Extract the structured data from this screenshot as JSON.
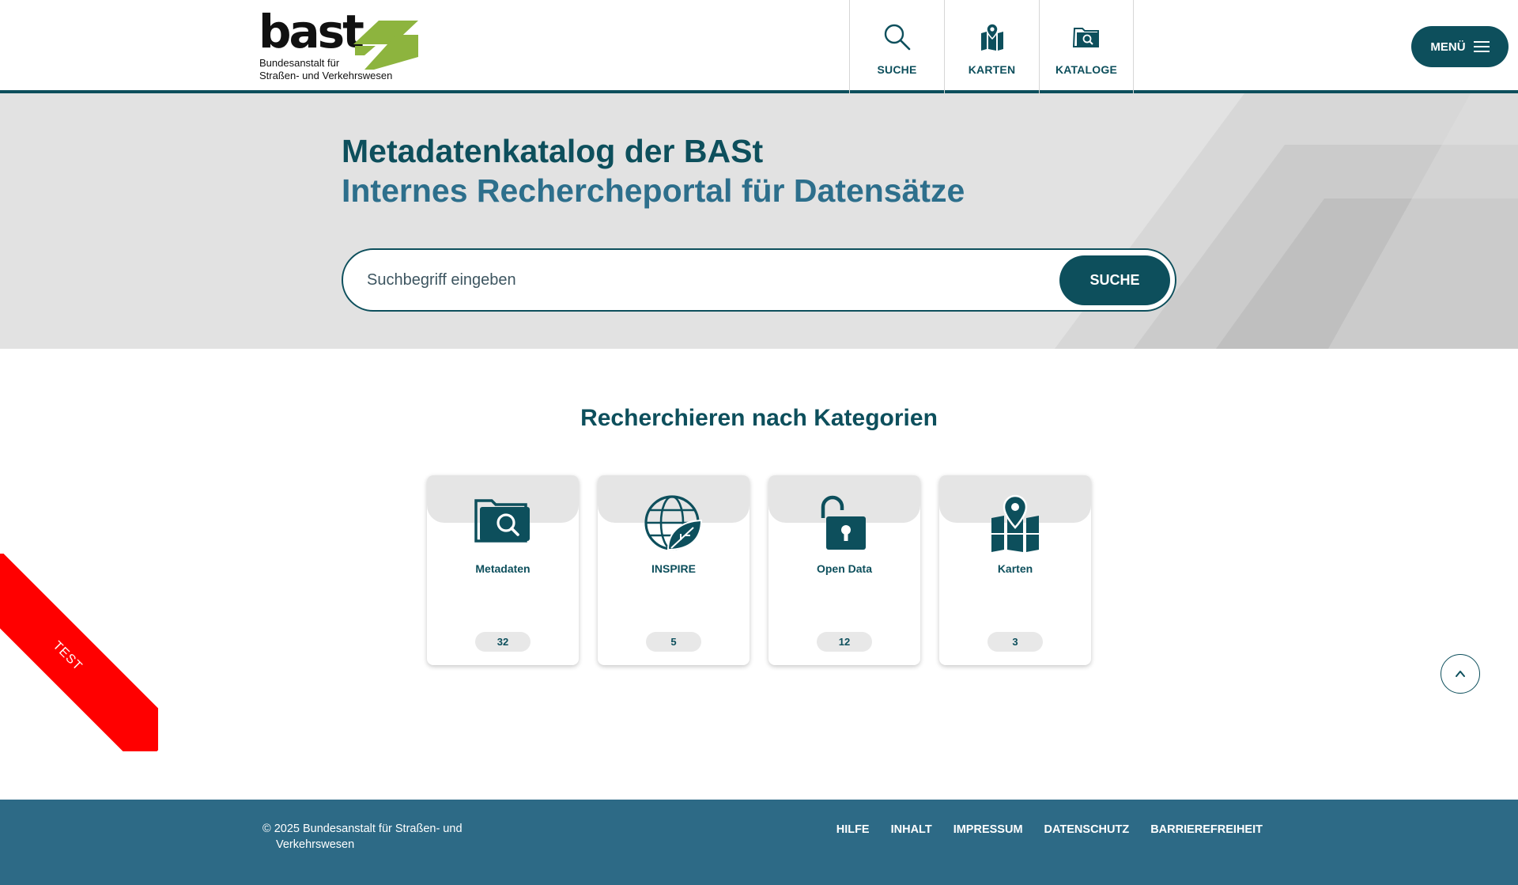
{
  "logo": {
    "wordmark": "bast",
    "subtitle_line1": "Bundesanstalt für",
    "subtitle_line2": "Straßen- und Verkehrswesen"
  },
  "nav": {
    "items": [
      {
        "label": "SUCHE",
        "icon": "search-icon"
      },
      {
        "label": "KARTEN",
        "icon": "map-icon"
      },
      {
        "label": "KATALOGE",
        "icon": "catalog-folder-icon"
      }
    ],
    "menu_label": "MENÜ"
  },
  "hero": {
    "title": "Metadatenkatalog der BASt",
    "subtitle": "Internes Rechercheportal für Datensätze",
    "search_placeholder": "Suchbegriff eingeben",
    "search_button": "SUCHE"
  },
  "categories": {
    "heading": "Recherchieren nach Kategorien",
    "items": [
      {
        "label": "Metadaten",
        "count": "32",
        "icon": "folder-search-icon"
      },
      {
        "label": "INSPIRE",
        "count": "5",
        "icon": "globe-leaf-icon"
      },
      {
        "label": "Open Data",
        "count": "12",
        "icon": "open-lock-icon"
      },
      {
        "label": "Karten",
        "count": "3",
        "icon": "map-pin-icon"
      }
    ]
  },
  "ribbon": {
    "label": "TEST"
  },
  "footer": {
    "copyright": "© 2025 Bundesanstalt für Straßen- und Verkehrswesen",
    "links": [
      "HILFE",
      "INHALT",
      "IMPRESSUM",
      "DATENSCHUTZ",
      "BARRIEREFREIHEIT"
    ]
  },
  "colors": {
    "primary": "#0d4f5c",
    "secondary": "#2d6f8c",
    "footer": "#2d6a86",
    "hero_bg": "#e2e2e2",
    "logo_green": "#8db43e",
    "ribbon": "#ff0000"
  }
}
